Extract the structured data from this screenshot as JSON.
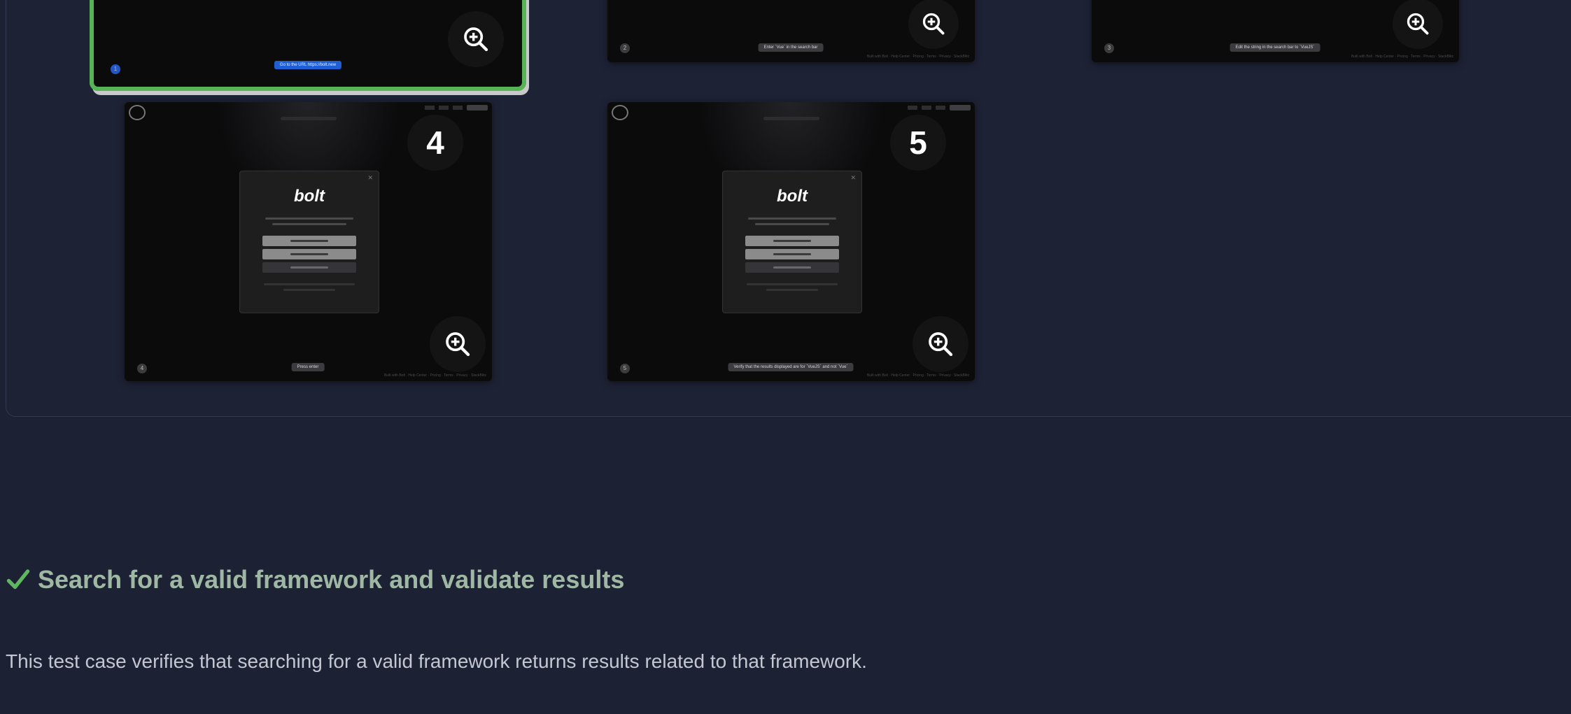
{
  "screenshots": [
    {
      "caption": "Go to the URL https://bolt.new",
      "step": "",
      "selected": true,
      "dot": "1"
    },
    {
      "caption": "Enter `Vue` in the search bar",
      "step": "",
      "selected": false,
      "dot": "2",
      "footer": "Built with Bolt · Help Center · Pricing · Terms · Privacy · StackBlitz"
    },
    {
      "caption": "Edit the string in the search bar to `VueJS`",
      "step": "",
      "selected": false,
      "dot": "3",
      "footer": "Built with Bolt · Help Center · Pricing · Terms · Privacy · StackBlitz"
    },
    {
      "caption": "Press enter",
      "step": "4",
      "selected": false,
      "dot": "4",
      "footer": "Built with Bolt · Help Center · Pricing · Terms · Privacy · StackBlitz",
      "modal_brand": "bolt"
    },
    {
      "caption": "Verify that the results displayed are for `VueJS` and not `Vue`",
      "step": "5",
      "selected": false,
      "dot": "5",
      "footer": "Built with Bolt · Help Center · Pricing · Terms · Privacy · StackBlitz",
      "modal_brand": "bolt"
    }
  ],
  "zoom_icon": "zoom-in-icon",
  "test_case": {
    "status_icon": "checkmark-icon",
    "title": "Search for a valid framework and validate results",
    "description": "This test case verifies that searching for a valid framework returns results related to that framework."
  },
  "colors": {
    "background": "#1d2134",
    "success": "#5fb85f",
    "selection_outline": "#56b356"
  }
}
